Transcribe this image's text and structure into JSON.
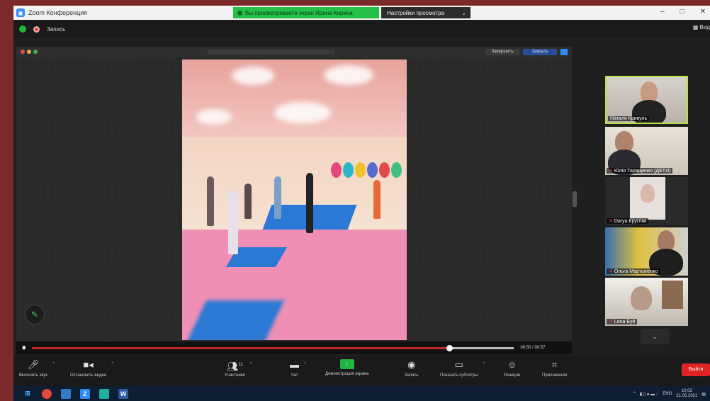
{
  "window": {
    "title": "Zoom Конференция",
    "controls": [
      "–",
      "□",
      "✕"
    ]
  },
  "share_banner": {
    "text": "Вы просматриваете экран Ирина Кирина",
    "view_options_label": "Настройки просмотра",
    "view_options_caret": "⌄"
  },
  "info_bar": {
    "record_label": "Запись",
    "view_label": "Вид"
  },
  "inner_window": {
    "btn_primary": "Завершить",
    "btn_secondary": "Закрыть"
  },
  "player": {
    "play_pause_icon": "⏸",
    "progress": 0.92,
    "timecode": "00:50 / 00:57"
  },
  "gallery": [
    {
      "name": "Наталя Кривуль",
      "active": true,
      "muted": false
    },
    {
      "name": "Юлія Таращенко (ДЕТИ)",
      "active": false,
      "muted": true
    },
    {
      "name": "Darya Кругляк",
      "active": false,
      "muted": true
    },
    {
      "name": "Ольга Мартыненко",
      "active": false,
      "muted": true
    },
    {
      "name": "Lena Буй",
      "active": false,
      "muted": true
    }
  ],
  "gallery_scroll": "⌄",
  "toolbar": {
    "audio": "Включить звук",
    "video": "Остановить видео",
    "participants": "Участники",
    "participants_count": "11",
    "chat": "Чат",
    "share": "Демонстрация экрана",
    "record": "Запись",
    "captions": "Показать субтитры",
    "reactions": "Реакции",
    "apps": "Приложения",
    "end": "Выйти"
  },
  "taskbar": {
    "lang": "ENG",
    "time": "10:02",
    "date": "21.05.2021"
  },
  "colors": {
    "zoom_blue": "#2d8cff",
    "share_green": "#25c04a",
    "end_red": "#e02424",
    "active_border": "#b9e04a"
  }
}
